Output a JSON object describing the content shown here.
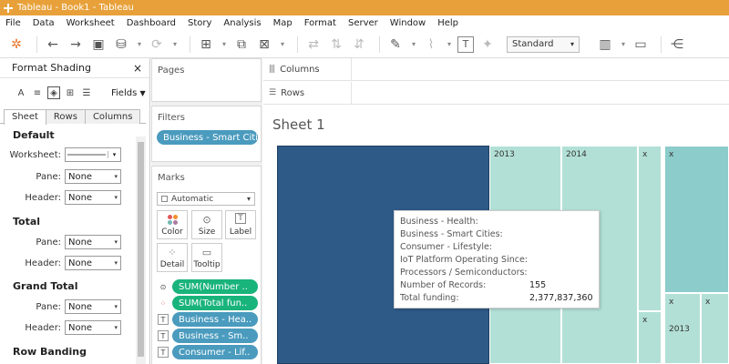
{
  "window": {
    "title": "Tableau - Book1 - Tableau"
  },
  "menu": [
    "File",
    "Data",
    "Worksheet",
    "Dashboard",
    "Story",
    "Analysis",
    "Map",
    "Format",
    "Server",
    "Window",
    "Help"
  ],
  "toolbar": {
    "fit_select": "Standard",
    "icons": [
      "tableau-logo-icon",
      "undo-icon",
      "redo-icon",
      "save-icon",
      "new-data-source-icon",
      "refresh-icon",
      "new-worksheet-icon",
      "duplicate-icon",
      "clear-icon",
      "swap-icon",
      "sort-ascending-icon",
      "sort-descending-icon",
      "group-icon",
      "highlight-icon",
      "attach-icon",
      "show-labels-icon",
      "pin-icon",
      "show-me-icon",
      "presentation-icon",
      "share-icon"
    ]
  },
  "format_panel": {
    "title": "Format Shading",
    "fields_label": "Fields",
    "tabs": [
      "Sheet",
      "Rows",
      "Columns"
    ],
    "active_tab": "Sheet",
    "sections": {
      "default": {
        "title": "Default",
        "worksheet_label": "Worksheet:",
        "pane_label": "Pane:",
        "pane_value": "None",
        "header_label": "Header:",
        "header_value": "None"
      },
      "total": {
        "title": "Total",
        "pane_label": "Pane:",
        "pane_value": "None",
        "header_label": "Header:",
        "header_value": "None"
      },
      "grand_total": {
        "title": "Grand Total",
        "pane_label": "Pane:",
        "pane_value": "None",
        "header_label": "Header:",
        "header_value": "None"
      },
      "row_banding": {
        "title": "Row Banding"
      }
    }
  },
  "pages": {
    "title": "Pages"
  },
  "filters": {
    "title": "Filters",
    "items": [
      "Business - Smart Citi.."
    ]
  },
  "marks": {
    "title": "Marks",
    "type": "Automatic",
    "buttons": {
      "color": "Color",
      "size": "Size",
      "label": "Label",
      "detail": "Detail",
      "tooltip": "Tooltip"
    },
    "fields": [
      {
        "label": "SUM(Number ..",
        "color": "green",
        "icon": "size-icon"
      },
      {
        "label": "SUM(Total fun..",
        "color": "green",
        "icon": "color-icon"
      },
      {
        "label": "Business - Hea..",
        "color": "blue",
        "icon": "text-icon"
      },
      {
        "label": "Business - Sm..",
        "color": "blue",
        "icon": "text-icon"
      },
      {
        "label": "Consumer - Lif..",
        "color": "blue",
        "icon": "text-icon"
      }
    ]
  },
  "shelves": {
    "columns": "Columns",
    "rows": "Rows"
  },
  "sheet": {
    "title": "Sheet 1",
    "treemap_labels": [
      "2013",
      "2014",
      "x",
      "x",
      "x",
      "x",
      "x",
      "2013"
    ]
  },
  "tooltip": {
    "rows": [
      {
        "key": "Business - Health:",
        "value": ""
      },
      {
        "key": "Business - Smart Cities:",
        "value": ""
      },
      {
        "key": "Consumer - Lifestyle:",
        "value": ""
      },
      {
        "key": "IoT Platform Operating Since:",
        "value": ""
      },
      {
        "key": "Processors / Semiconductors:",
        "value": ""
      },
      {
        "key": "Number of Records:",
        "value": "155"
      },
      {
        "key": "Total funding:",
        "value": "2,377,837,360"
      }
    ]
  },
  "colors": {
    "titlebar": "#e8a13a",
    "treemap_dark": "#2e5a87",
    "treemap_light": "#b2e0d6",
    "treemap_mid": "#8cccca",
    "pill_blue": "#4a9bbe",
    "pill_green": "#19b37c"
  }
}
